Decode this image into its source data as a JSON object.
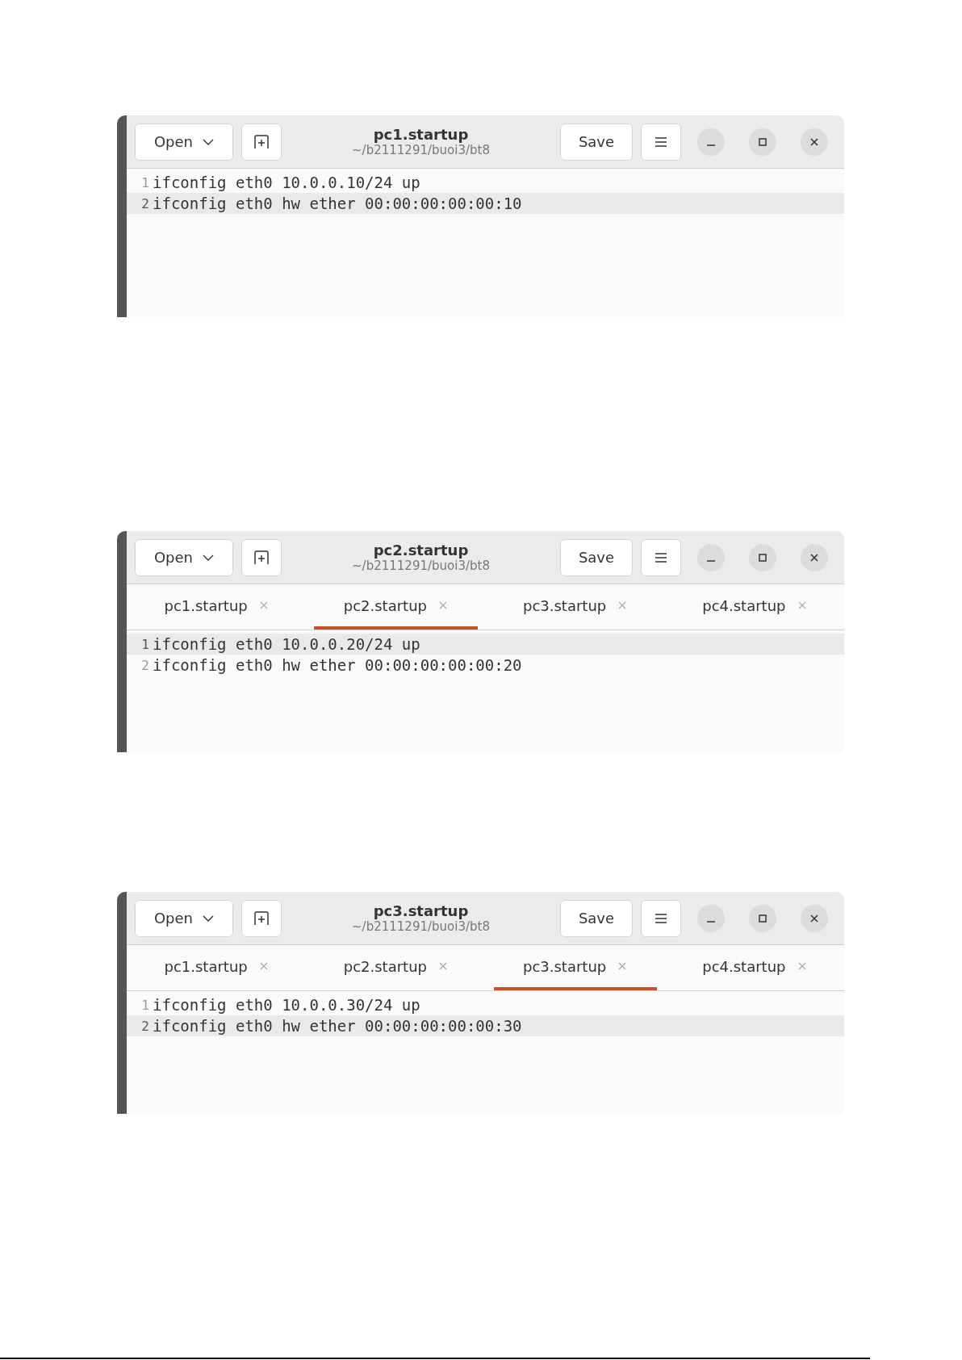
{
  "windows": [
    {
      "title": "pc1.startup",
      "subtitle": "~/b2111291/buoi3/bt8",
      "open_label": "Open",
      "save_label": "Save",
      "lines": [
        {
          "number": "1",
          "text": "ifconfig eth0 10.0.0.10/24 up",
          "current": false
        },
        {
          "number": "2",
          "text": "ifconfig eth0 hw ether 00:00:00:00:00:10",
          "current": true
        }
      ]
    },
    {
      "title": "pc2.startup",
      "subtitle": "~/b2111291/buoi3/bt8",
      "open_label": "Open",
      "save_label": "Save",
      "tabs": [
        {
          "label": "pc1.startup",
          "selected": false
        },
        {
          "label": "pc2.startup",
          "selected": true
        },
        {
          "label": "pc3.startup",
          "selected": false
        },
        {
          "label": "pc4.startup",
          "selected": false
        }
      ],
      "lines": [
        {
          "number": "1",
          "text": "ifconfig eth0 10.0.0.20/24 up",
          "current": true
        },
        {
          "number": "2",
          "text": "ifconfig eth0 hw ether 00:00:00:00:00:20",
          "current": false
        }
      ]
    },
    {
      "title": "pc3.startup",
      "subtitle": "~/b2111291/buoi3/bt8",
      "open_label": "Open",
      "save_label": "Save",
      "tabs": [
        {
          "label": "pc1.startup",
          "selected": false
        },
        {
          "label": "pc2.startup",
          "selected": false
        },
        {
          "label": "pc3.startup",
          "selected": true
        },
        {
          "label": "pc4.startup",
          "selected": false
        }
      ],
      "lines": [
        {
          "number": "1",
          "text": "ifconfig eth0 10.0.0.30/24 up",
          "current": false
        },
        {
          "number": "2",
          "text": "ifconfig eth0 hw ether 00:00:00:00:00:30",
          "current": true
        }
      ]
    }
  ]
}
